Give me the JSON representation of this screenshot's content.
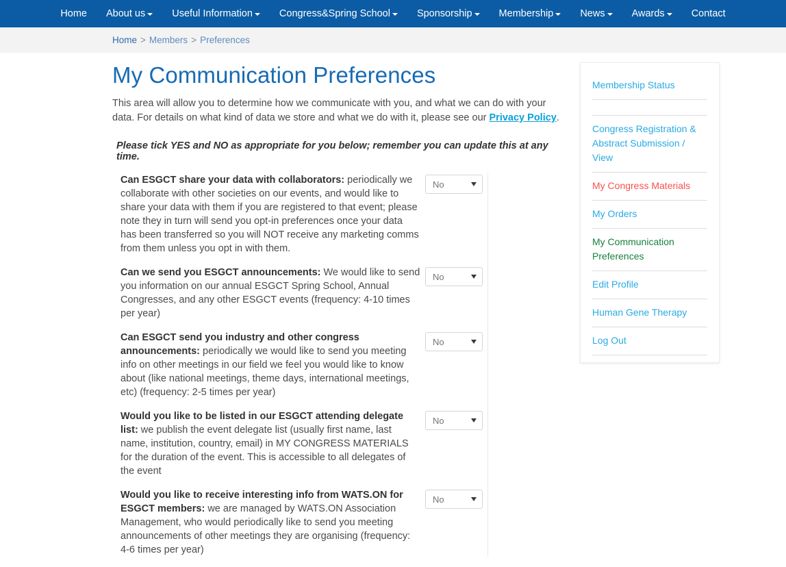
{
  "nav": {
    "items": [
      {
        "label": "Home",
        "has_caret": false
      },
      {
        "label": "About us",
        "has_caret": true
      },
      {
        "label": "Useful Information",
        "has_caret": true
      },
      {
        "label": "Congress&Spring School",
        "has_caret": true
      },
      {
        "label": "Sponsorship",
        "has_caret": true
      },
      {
        "label": "Membership",
        "has_caret": true
      },
      {
        "label": "News",
        "has_caret": true
      },
      {
        "label": "Awards",
        "has_caret": true
      },
      {
        "label": "Contact",
        "has_caret": false
      }
    ],
    "background_color": "#0b5ca5",
    "text_color": "#ffffff"
  },
  "breadcrumb": {
    "items": [
      "Home",
      "Members",
      "Preferences"
    ],
    "separator": ">"
  },
  "main": {
    "title": "My Communication Preferences",
    "intro_before_link": "This area will allow you to determine how we communicate with you, and what we can do with your data. For details on what kind of data we store and what we do with it, please see our ",
    "intro_link": "Privacy Policy",
    "intro_after_link": ".",
    "tick_note": "Please tick YES and NO as appropriate for you below; remember you can update this at any time.",
    "questions": [
      {
        "heading": "Can ESGCT share your data with collaborators:",
        "body": " periodically we collaborate with other societies on our events, and would like to share your data with them if you are registered to that event; please note they in turn will send you opt-in preferences once your data has been transferred so you will NOT receive any marketing comms from them unless you opt in with them.",
        "select_value": "No"
      },
      {
        "heading": "Can we send you ESGCT announcements:",
        "body": " We would like to send you information on our annual ESGCT Spring School, Annual Congresses, and any other ESGCT events (frequency: 4-10 times per year)",
        "select_value": "No"
      },
      {
        "heading": "Can ESGCT send you industry and other congress announcements:",
        "body": " periodically we would like to send you meeting info on other meetings in our field we feel you would like to know about (like national meetings, theme days, international meetings, etc) (frequency: 2-5 times per year)",
        "select_value": "No"
      },
      {
        "heading": "Would you like to be listed in our ESGCT attending delegate list:",
        "body": " we publish the event delegate list (usually first name, last name, institution, country, email) in MY CONGRESS MATERIALS for the duration of the event. This is accessible to all delegates of the event",
        "select_value": "No"
      },
      {
        "heading": "Would you like to receive interesting info from WATS.ON for ESGCT members:",
        "body": " we are managed by WATS.ON Association Management, who would periodically like to send you meeting announcements of other meetings they are organising (frequency: 4-6 times per year)",
        "select_value": "No"
      }
    ]
  },
  "sidebar": {
    "items": [
      {
        "label": "Membership Status",
        "state": "link"
      },
      {
        "label": "",
        "state": "blank"
      },
      {
        "label": "Congress Registration & Abstract Submission / View",
        "state": "link"
      },
      {
        "label": "My Congress Materials",
        "state": "red"
      },
      {
        "label": "My Orders",
        "state": "link"
      },
      {
        "label": "My Communication Preferences",
        "state": "green"
      },
      {
        "label": "Edit Profile",
        "state": "link"
      },
      {
        "label": "Human Gene Therapy",
        "state": "link"
      },
      {
        "label": "Log Out",
        "state": "link"
      }
    ]
  },
  "colors": {
    "nav_blue": "#0b5ca5",
    "title_blue": "#176bb3",
    "link_blue": "#29abe2",
    "active_green": "#17813c",
    "alert_red": "#f8514f",
    "breadcrumb_bg": "#f3f3f3"
  }
}
